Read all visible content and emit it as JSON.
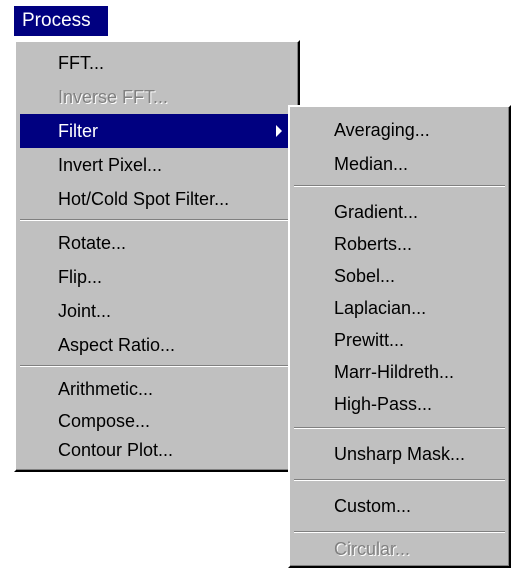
{
  "menubar": {
    "title": "Process"
  },
  "main_menu": {
    "items": [
      {
        "label": "FFT...",
        "enabled": true
      },
      {
        "label": "Inverse FFT...",
        "enabled": false
      },
      {
        "label": "Filter",
        "enabled": true,
        "has_submenu": true,
        "highlighted": true
      },
      {
        "label": "Invert Pixel...",
        "enabled": true
      },
      {
        "label": "Hot/Cold Spot Filter...",
        "enabled": true
      },
      {
        "label": "Rotate...",
        "enabled": true
      },
      {
        "label": "Flip...",
        "enabled": true
      },
      {
        "label": "Joint...",
        "enabled": true
      },
      {
        "label": "Aspect Ratio...",
        "enabled": true
      },
      {
        "label": "Arithmetic...",
        "enabled": true
      },
      {
        "label": "Compose...",
        "enabled": true
      },
      {
        "label": "Contour Plot...",
        "enabled": true
      }
    ]
  },
  "filter_submenu": {
    "items": [
      {
        "label": "Averaging...",
        "enabled": true
      },
      {
        "label": "Median...",
        "enabled": true
      },
      {
        "label": "Gradient...",
        "enabled": true
      },
      {
        "label": "Roberts...",
        "enabled": true
      },
      {
        "label": "Sobel...",
        "enabled": true
      },
      {
        "label": "Laplacian...",
        "enabled": true
      },
      {
        "label": "Prewitt...",
        "enabled": true
      },
      {
        "label": "Marr-Hildreth...",
        "enabled": true
      },
      {
        "label": "High-Pass...",
        "enabled": true
      },
      {
        "label": "Unsharp Mask...",
        "enabled": true
      },
      {
        "label": "Custom...",
        "enabled": true
      },
      {
        "label": "Circular...",
        "enabled": false
      }
    ]
  },
  "colors": {
    "menu_background": "#c0c0c0",
    "highlight": "#000080",
    "highlight_text": "#ffffff",
    "disabled_text": "#808080"
  },
  "icons": {
    "submenu_arrow": "triangle-right-icon"
  }
}
